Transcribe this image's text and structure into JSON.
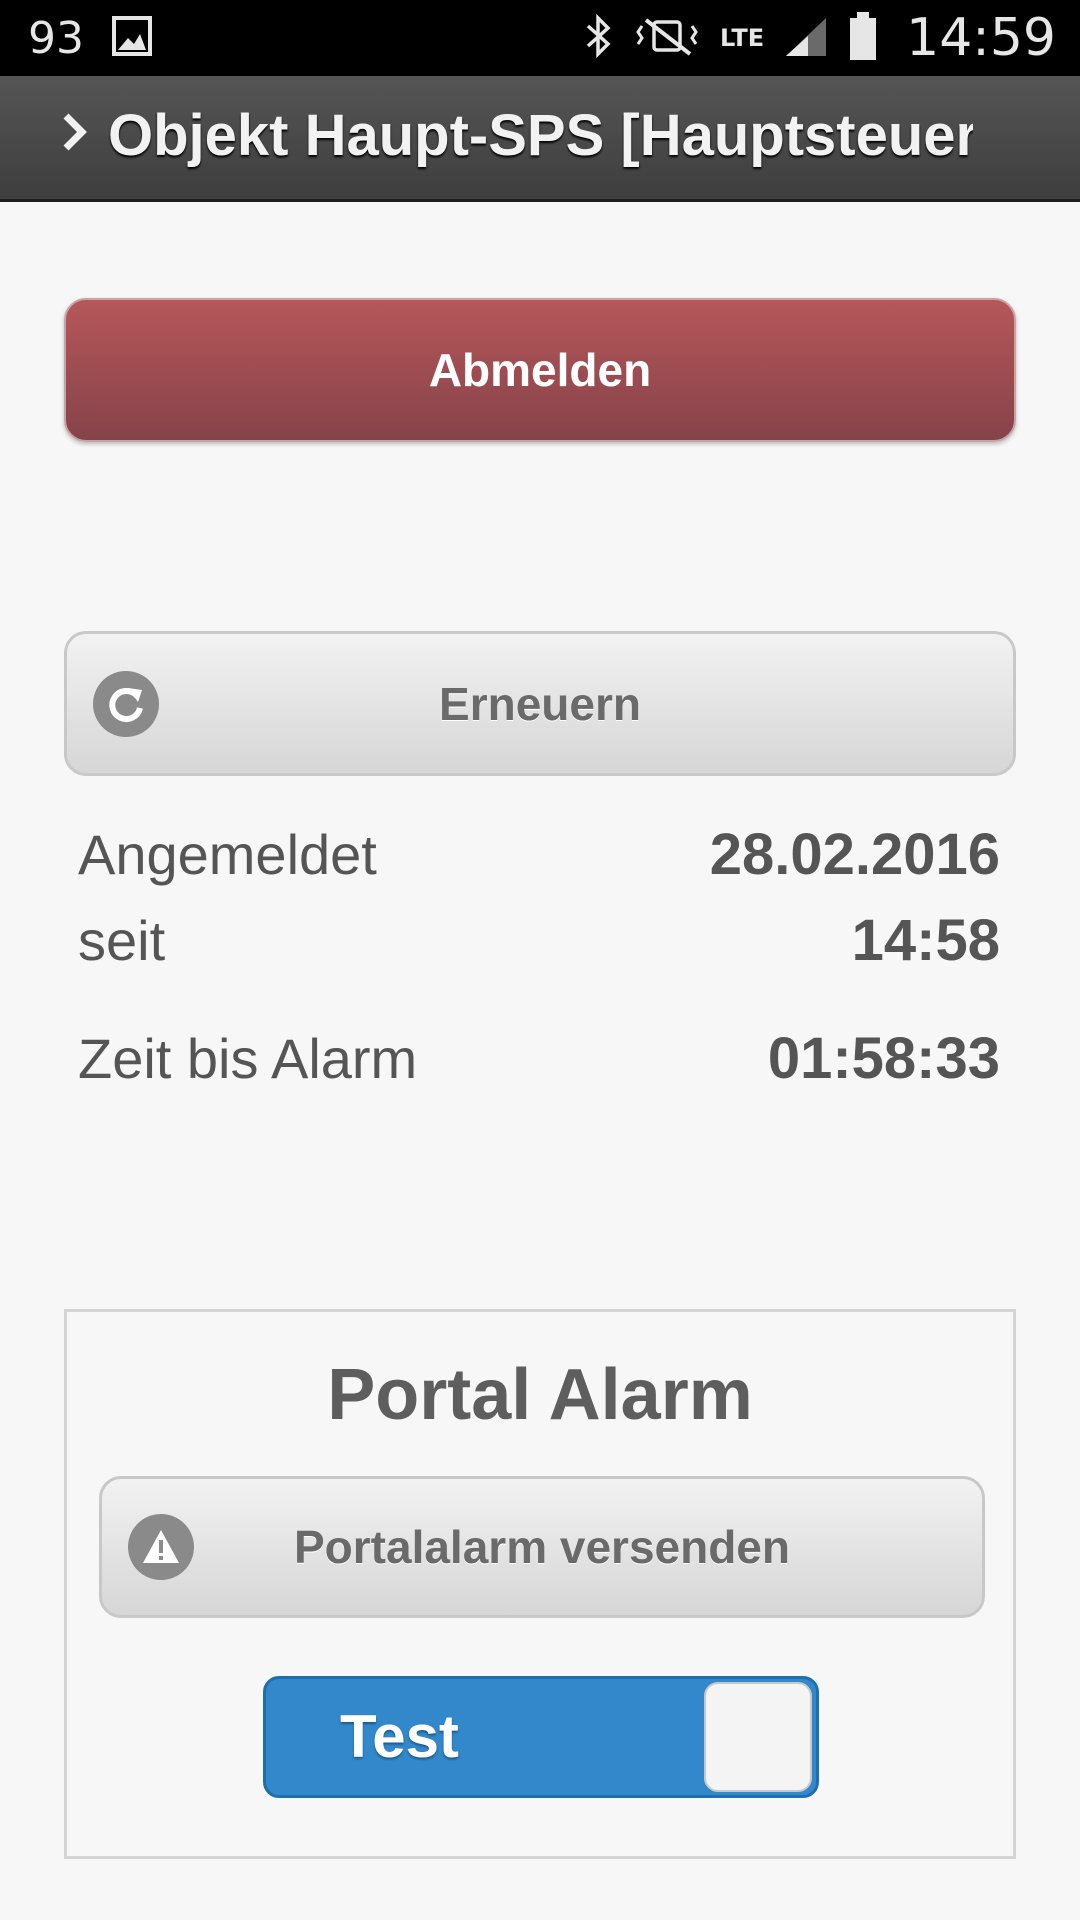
{
  "status_bar": {
    "left_number": "93",
    "network_label": "LTE",
    "time": "14:59"
  },
  "header": {
    "title": "Objekt Haupt-SPS [Hauptsteuerung]"
  },
  "actions": {
    "logout_label": "Abmelden",
    "renew_label": "Erneuern"
  },
  "info": {
    "logged_in_label_line1": "Angemeldet",
    "logged_in_label_line2": "seit",
    "logged_in_date": "28.02.2016",
    "logged_in_time": "14:58",
    "time_to_alarm_label": "Zeit bis Alarm",
    "time_to_alarm_value": "01:58:33"
  },
  "portal": {
    "title": "Portal Alarm",
    "send_label": "Portalalarm versenden",
    "test_toggle_label": "Test",
    "test_toggle_on": true
  },
  "colors": {
    "logout_button": "#a14f54",
    "toggle_on": "#3388cc",
    "header_bg": "#4a4a4a"
  },
  "icons": {
    "renew": "refresh-icon",
    "portal_send": "warning-icon",
    "header": "chevron-right-icon"
  }
}
